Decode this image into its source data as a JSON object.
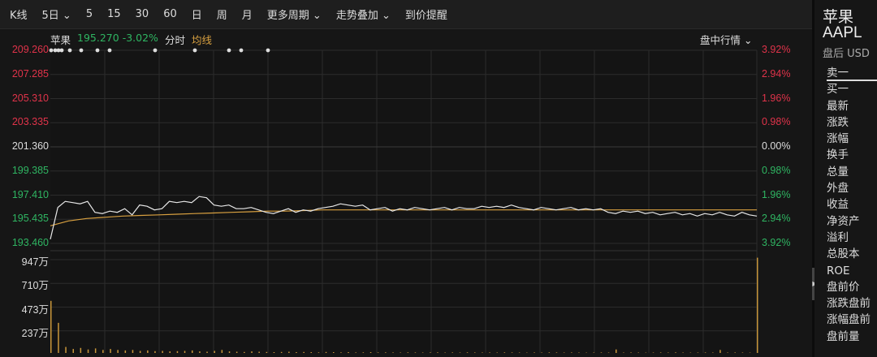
{
  "toolbar": {
    "tabs": [
      "K线",
      "5日 ⌄",
      "5",
      "15",
      "30",
      "60",
      "日",
      "周",
      "月",
      "更多周期 ⌄",
      "走势叠加 ⌄",
      "到价提醒"
    ]
  },
  "info": {
    "name": "苹果",
    "price": "195.270",
    "change": "-3.02%",
    "mode": "分时",
    "avg": "均线",
    "intraday": "盘中行情 ⌄"
  },
  "colors": {
    "up": "#e0334a",
    "down": "#2fb562",
    "price_line": "#e8e8e8",
    "avg_line": "#d8a040",
    "volume": "#c8963a"
  },
  "chart_data": {
    "type": "line",
    "y_left_ticks": [
      "209.260",
      "207.285",
      "205.310",
      "203.335",
      "201.360",
      "199.385",
      "197.410",
      "195.435",
      "193.460"
    ],
    "y_right_ticks": [
      "3.92%",
      "2.94%",
      "1.96%",
      "0.98%",
      "0.00%",
      "0.98%",
      "1.96%",
      "2.94%",
      "3.92%"
    ],
    "ylim": [
      193.46,
      209.26
    ],
    "price": [
      193.8,
      196.4,
      196.9,
      196.8,
      196.7,
      196.9,
      196.0,
      195.9,
      196.1,
      196.0,
      196.3,
      195.8,
      196.6,
      196.5,
      196.2,
      196.3,
      196.9,
      196.8,
      196.9,
      196.8,
      197.3,
      197.2,
      196.6,
      196.5,
      196.6,
      196.3,
      196.3,
      196.4,
      196.2,
      196.0,
      195.9,
      196.1,
      196.3,
      196.0,
      196.2,
      196.1,
      196.3,
      196.4,
      196.5,
      196.7,
      196.6,
      196.5,
      196.6,
      196.2,
      196.3,
      196.4,
      196.1,
      196.3,
      196.2,
      196.4,
      196.3,
      196.2,
      196.3,
      196.4,
      196.2,
      196.4,
      196.3,
      196.3,
      196.5,
      196.4,
      196.5,
      196.4,
      196.6,
      196.4,
      196.3,
      196.2,
      196.4,
      196.3,
      196.2,
      196.3,
      196.4,
      196.2,
      196.3,
      196.2,
      196.3,
      196.0,
      195.9,
      196.1,
      196.0,
      196.1,
      195.9,
      196.0,
      195.8,
      195.9,
      196.0,
      195.8,
      195.9,
      195.7,
      195.9,
      195.8,
      196.0,
      195.8,
      195.7,
      196.0,
      195.8,
      195.7
    ],
    "avg": [
      194.9,
      195.3,
      195.5,
      195.6,
      195.7,
      195.75,
      195.8,
      195.85,
      195.9,
      195.95,
      196.0,
      196.05,
      196.1,
      196.1,
      196.15,
      196.2,
      196.2,
      196.2,
      196.2,
      196.2,
      196.2,
      196.2,
      196.2,
      196.2,
      196.2,
      196.2,
      196.2,
      196.2,
      196.2,
      196.2,
      196.2,
      196.2,
      196.2,
      196.2,
      196.2,
      196.2,
      196.2,
      196.2,
      196.2,
      196.2
    ],
    "volume_ticks": [
      "947万",
      "710万",
      "473万",
      "237万"
    ],
    "volume_max": 947,
    "volume": [
      520,
      300,
      60,
      40,
      50,
      35,
      45,
      30,
      40,
      30,
      25,
      30,
      20,
      25,
      18,
      20,
      15,
      18,
      20,
      25,
      15,
      12,
      20,
      30,
      15,
      12,
      10,
      15,
      12,
      10,
      8,
      10,
      12,
      8,
      10,
      8,
      6,
      10,
      8,
      6,
      8,
      5,
      6,
      8,
      5,
      6,
      5,
      4,
      6,
      5,
      4,
      5,
      6,
      4,
      5,
      4,
      6,
      5,
      4,
      5,
      4,
      6,
      5,
      4,
      3,
      5,
      4,
      6,
      5,
      4,
      5,
      4,
      3,
      4,
      5,
      4,
      35,
      4,
      5,
      4,
      3,
      4,
      5,
      4,
      6,
      4,
      3,
      4,
      5,
      4,
      30,
      4,
      5,
      4,
      3,
      950
    ]
  },
  "side": {
    "name": "苹果",
    "code": "AAPL",
    "session": "盘后 USD",
    "items": [
      "卖一",
      "买一",
      "最新",
      "涨跌",
      "涨幅",
      "换手",
      "总量",
      "外盘",
      "收益",
      "净资产",
      "溢利",
      "总股本",
      "ROE",
      "盘前价",
      "涨跌盘前",
      "涨幅盘前",
      "盘前量"
    ]
  }
}
